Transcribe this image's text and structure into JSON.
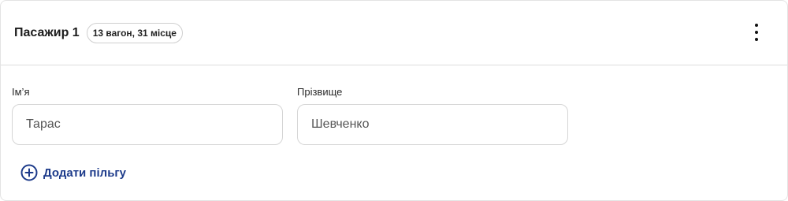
{
  "passenger": {
    "title": "Пасажир 1",
    "seat_badge": "13 вагон, 31 місце"
  },
  "menu": {
    "icon": "more-vertical-icon"
  },
  "form": {
    "first_name": {
      "label": "Ім’я",
      "value": "Тарас"
    },
    "last_name": {
      "label": "Прізвище",
      "value": "Шевченко"
    }
  },
  "actions": {
    "add_discount_label": "Додати пільгу",
    "add_discount_icon": "plus-circle-icon"
  },
  "colors": {
    "accent": "#1c3a8a",
    "border": "#d5d5d5"
  }
}
